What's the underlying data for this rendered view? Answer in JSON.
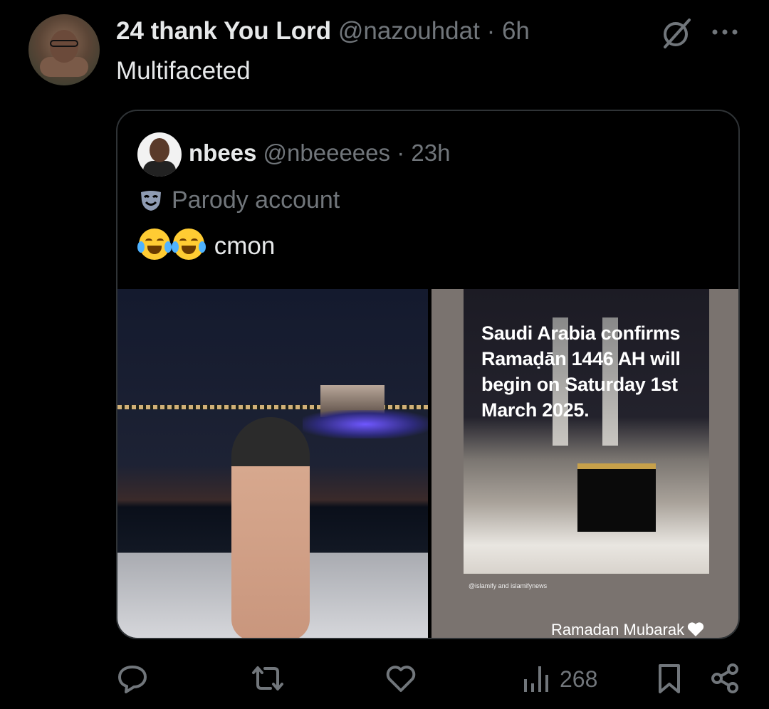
{
  "post": {
    "author_name": "24 thank You Lord",
    "handle": "@nazouhdat",
    "separator": "·",
    "time": "6h",
    "text": "Multifaceted"
  },
  "quote": {
    "author_name": "nbees",
    "handle": "@nbeeeees",
    "separator": "·",
    "time": "23h",
    "label": "Parody account",
    "text": "cmon",
    "media_right": {
      "headline": "Saudi Arabia confirms Ramaḍān 1446 AH will begin on Saturday 1st March 2025.",
      "credit": "@islamify and islamifynews",
      "footer": "Ramadan Mubarak"
    }
  },
  "actions": {
    "views": "268"
  },
  "icons": {
    "header": [
      "grok-icon",
      "more-icon"
    ],
    "quote": [
      "parody-mask-icon",
      "tears-of-joy-emoji"
    ],
    "bar": [
      "reply-icon",
      "repost-icon",
      "like-icon",
      "views-icon",
      "bookmark-icon",
      "share-icon"
    ]
  },
  "colors": {
    "background": "#000000",
    "text": "#e7e9ea",
    "muted": "#71767b",
    "border": "#2f3336"
  }
}
